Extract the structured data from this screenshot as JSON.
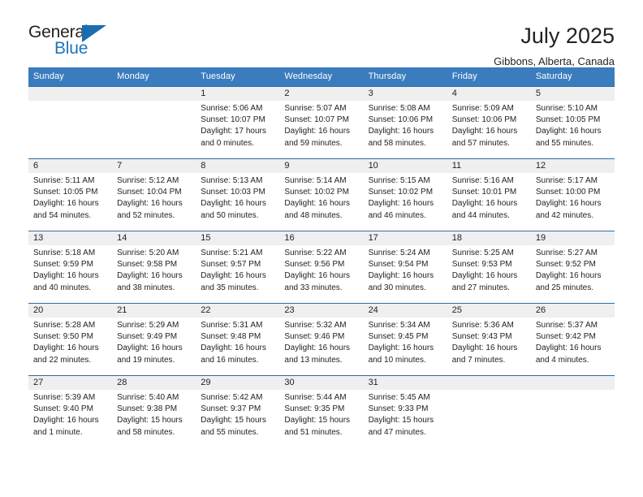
{
  "logo": {
    "word_top": "General",
    "word_bottom": "Blue",
    "triangle": "triangle-icon",
    "accent_color": "#1b75bb"
  },
  "header": {
    "title": "July 2025",
    "location": "Gibbons, Alberta, Canada"
  },
  "theme": {
    "header_row_bg": "#3a7cbe",
    "band_bg": "#efefef",
    "separator": "#2e6da4"
  },
  "calendar": {
    "weekday_headers": [
      "Sunday",
      "Monday",
      "Tuesday",
      "Wednesday",
      "Thursday",
      "Friday",
      "Saturday"
    ],
    "weeks": [
      [
        {
          "day": "",
          "sunrise": "",
          "sunset": "",
          "daylight_line1": "",
          "daylight_line2": ""
        },
        {
          "day": "",
          "sunrise": "",
          "sunset": "",
          "daylight_line1": "",
          "daylight_line2": ""
        },
        {
          "day": "1",
          "sunrise": "Sunrise: 5:06 AM",
          "sunset": "Sunset: 10:07 PM",
          "daylight_line1": "Daylight: 17 hours",
          "daylight_line2": "and 0 minutes."
        },
        {
          "day": "2",
          "sunrise": "Sunrise: 5:07 AM",
          "sunset": "Sunset: 10:07 PM",
          "daylight_line1": "Daylight: 16 hours",
          "daylight_line2": "and 59 minutes."
        },
        {
          "day": "3",
          "sunrise": "Sunrise: 5:08 AM",
          "sunset": "Sunset: 10:06 PM",
          "daylight_line1": "Daylight: 16 hours",
          "daylight_line2": "and 58 minutes."
        },
        {
          "day": "4",
          "sunrise": "Sunrise: 5:09 AM",
          "sunset": "Sunset: 10:06 PM",
          "daylight_line1": "Daylight: 16 hours",
          "daylight_line2": "and 57 minutes."
        },
        {
          "day": "5",
          "sunrise": "Sunrise: 5:10 AM",
          "sunset": "Sunset: 10:05 PM",
          "daylight_line1": "Daylight: 16 hours",
          "daylight_line2": "and 55 minutes."
        }
      ],
      [
        {
          "day": "6",
          "sunrise": "Sunrise: 5:11 AM",
          "sunset": "Sunset: 10:05 PM",
          "daylight_line1": "Daylight: 16 hours",
          "daylight_line2": "and 54 minutes."
        },
        {
          "day": "7",
          "sunrise": "Sunrise: 5:12 AM",
          "sunset": "Sunset: 10:04 PM",
          "daylight_line1": "Daylight: 16 hours",
          "daylight_line2": "and 52 minutes."
        },
        {
          "day": "8",
          "sunrise": "Sunrise: 5:13 AM",
          "sunset": "Sunset: 10:03 PM",
          "daylight_line1": "Daylight: 16 hours",
          "daylight_line2": "and 50 minutes."
        },
        {
          "day": "9",
          "sunrise": "Sunrise: 5:14 AM",
          "sunset": "Sunset: 10:02 PM",
          "daylight_line1": "Daylight: 16 hours",
          "daylight_line2": "and 48 minutes."
        },
        {
          "day": "10",
          "sunrise": "Sunrise: 5:15 AM",
          "sunset": "Sunset: 10:02 PM",
          "daylight_line1": "Daylight: 16 hours",
          "daylight_line2": "and 46 minutes."
        },
        {
          "day": "11",
          "sunrise": "Sunrise: 5:16 AM",
          "sunset": "Sunset: 10:01 PM",
          "daylight_line1": "Daylight: 16 hours",
          "daylight_line2": "and 44 minutes."
        },
        {
          "day": "12",
          "sunrise": "Sunrise: 5:17 AM",
          "sunset": "Sunset: 10:00 PM",
          "daylight_line1": "Daylight: 16 hours",
          "daylight_line2": "and 42 minutes."
        }
      ],
      [
        {
          "day": "13",
          "sunrise": "Sunrise: 5:18 AM",
          "sunset": "Sunset: 9:59 PM",
          "daylight_line1": "Daylight: 16 hours",
          "daylight_line2": "and 40 minutes."
        },
        {
          "day": "14",
          "sunrise": "Sunrise: 5:20 AM",
          "sunset": "Sunset: 9:58 PM",
          "daylight_line1": "Daylight: 16 hours",
          "daylight_line2": "and 38 minutes."
        },
        {
          "day": "15",
          "sunrise": "Sunrise: 5:21 AM",
          "sunset": "Sunset: 9:57 PM",
          "daylight_line1": "Daylight: 16 hours",
          "daylight_line2": "and 35 minutes."
        },
        {
          "day": "16",
          "sunrise": "Sunrise: 5:22 AM",
          "sunset": "Sunset: 9:56 PM",
          "daylight_line1": "Daylight: 16 hours",
          "daylight_line2": "and 33 minutes."
        },
        {
          "day": "17",
          "sunrise": "Sunrise: 5:24 AM",
          "sunset": "Sunset: 9:54 PM",
          "daylight_line1": "Daylight: 16 hours",
          "daylight_line2": "and 30 minutes."
        },
        {
          "day": "18",
          "sunrise": "Sunrise: 5:25 AM",
          "sunset": "Sunset: 9:53 PM",
          "daylight_line1": "Daylight: 16 hours",
          "daylight_line2": "and 27 minutes."
        },
        {
          "day": "19",
          "sunrise": "Sunrise: 5:27 AM",
          "sunset": "Sunset: 9:52 PM",
          "daylight_line1": "Daylight: 16 hours",
          "daylight_line2": "and 25 minutes."
        }
      ],
      [
        {
          "day": "20",
          "sunrise": "Sunrise: 5:28 AM",
          "sunset": "Sunset: 9:50 PM",
          "daylight_line1": "Daylight: 16 hours",
          "daylight_line2": "and 22 minutes."
        },
        {
          "day": "21",
          "sunrise": "Sunrise: 5:29 AM",
          "sunset": "Sunset: 9:49 PM",
          "daylight_line1": "Daylight: 16 hours",
          "daylight_line2": "and 19 minutes."
        },
        {
          "day": "22",
          "sunrise": "Sunrise: 5:31 AM",
          "sunset": "Sunset: 9:48 PM",
          "daylight_line1": "Daylight: 16 hours",
          "daylight_line2": "and 16 minutes."
        },
        {
          "day": "23",
          "sunrise": "Sunrise: 5:32 AM",
          "sunset": "Sunset: 9:46 PM",
          "daylight_line1": "Daylight: 16 hours",
          "daylight_line2": "and 13 minutes."
        },
        {
          "day": "24",
          "sunrise": "Sunrise: 5:34 AM",
          "sunset": "Sunset: 9:45 PM",
          "daylight_line1": "Daylight: 16 hours",
          "daylight_line2": "and 10 minutes."
        },
        {
          "day": "25",
          "sunrise": "Sunrise: 5:36 AM",
          "sunset": "Sunset: 9:43 PM",
          "daylight_line1": "Daylight: 16 hours",
          "daylight_line2": "and 7 minutes."
        },
        {
          "day": "26",
          "sunrise": "Sunrise: 5:37 AM",
          "sunset": "Sunset: 9:42 PM",
          "daylight_line1": "Daylight: 16 hours",
          "daylight_line2": "and 4 minutes."
        }
      ],
      [
        {
          "day": "27",
          "sunrise": "Sunrise: 5:39 AM",
          "sunset": "Sunset: 9:40 PM",
          "daylight_line1": "Daylight: 16 hours",
          "daylight_line2": "and 1 minute."
        },
        {
          "day": "28",
          "sunrise": "Sunrise: 5:40 AM",
          "sunset": "Sunset: 9:38 PM",
          "daylight_line1": "Daylight: 15 hours",
          "daylight_line2": "and 58 minutes."
        },
        {
          "day": "29",
          "sunrise": "Sunrise: 5:42 AM",
          "sunset": "Sunset: 9:37 PM",
          "daylight_line1": "Daylight: 15 hours",
          "daylight_line2": "and 55 minutes."
        },
        {
          "day": "30",
          "sunrise": "Sunrise: 5:44 AM",
          "sunset": "Sunset: 9:35 PM",
          "daylight_line1": "Daylight: 15 hours",
          "daylight_line2": "and 51 minutes."
        },
        {
          "day": "31",
          "sunrise": "Sunrise: 5:45 AM",
          "sunset": "Sunset: 9:33 PM",
          "daylight_line1": "Daylight: 15 hours",
          "daylight_line2": "and 47 minutes."
        },
        {
          "day": "",
          "sunrise": "",
          "sunset": "",
          "daylight_line1": "",
          "daylight_line2": ""
        },
        {
          "day": "",
          "sunrise": "",
          "sunset": "",
          "daylight_line1": "",
          "daylight_line2": ""
        }
      ]
    ]
  }
}
